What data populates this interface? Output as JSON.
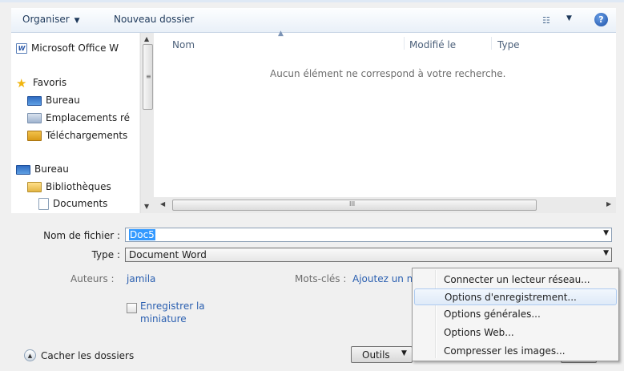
{
  "toolbar": {
    "organize_label": "Organiser",
    "new_folder_label": "Nouveau dossier",
    "view_icon": "list-view-icon",
    "help_icon": "help-icon",
    "help_glyph": "?"
  },
  "nav": {
    "items": [
      {
        "label": "Microsoft Office W",
        "icon": "office-icon"
      },
      {
        "label": "Favoris",
        "icon": "star-icon"
      },
      {
        "label": "Bureau",
        "icon": "desktop-icon"
      },
      {
        "label": "Emplacements ré",
        "icon": "recent-places-icon"
      },
      {
        "label": "Téléchargements",
        "icon": "downloads-icon"
      },
      {
        "label": "Bureau",
        "icon": "desktop-icon"
      },
      {
        "label": "Bibliothèques",
        "icon": "libraries-icon"
      },
      {
        "label": "Documents",
        "icon": "document-icon"
      }
    ]
  },
  "file_list": {
    "columns": [
      "Nom",
      "Modifié le",
      "Type"
    ],
    "empty_message": "Aucun élément ne correspond à votre recherche.",
    "hscroll_grip": "III"
  },
  "form": {
    "filename_label": "Nom de fichier :",
    "filename_value": "Doc5",
    "type_label": "Type :",
    "type_value": "Document Word",
    "authors_label": "Auteurs :",
    "authors_value": "jamila",
    "keywords_label": "Mots-clés :",
    "keywords_value": "Ajoutez un m",
    "thumbnail_label_line1": "Enregistrer la",
    "thumbnail_label_line2": "miniature",
    "thumbnail_checked": false
  },
  "footer": {
    "hide_folders_label": "Cacher les dossiers",
    "tools_label": "Outils"
  },
  "tools_menu": {
    "items": [
      {
        "label": "Connecter un lecteur réseau..."
      },
      {
        "label": "Options d'enregistrement..."
      },
      {
        "label": "Options générales..."
      },
      {
        "label": "Options Web..."
      },
      {
        "label": "Compresser les images..."
      }
    ],
    "highlighted_index": 1
  }
}
